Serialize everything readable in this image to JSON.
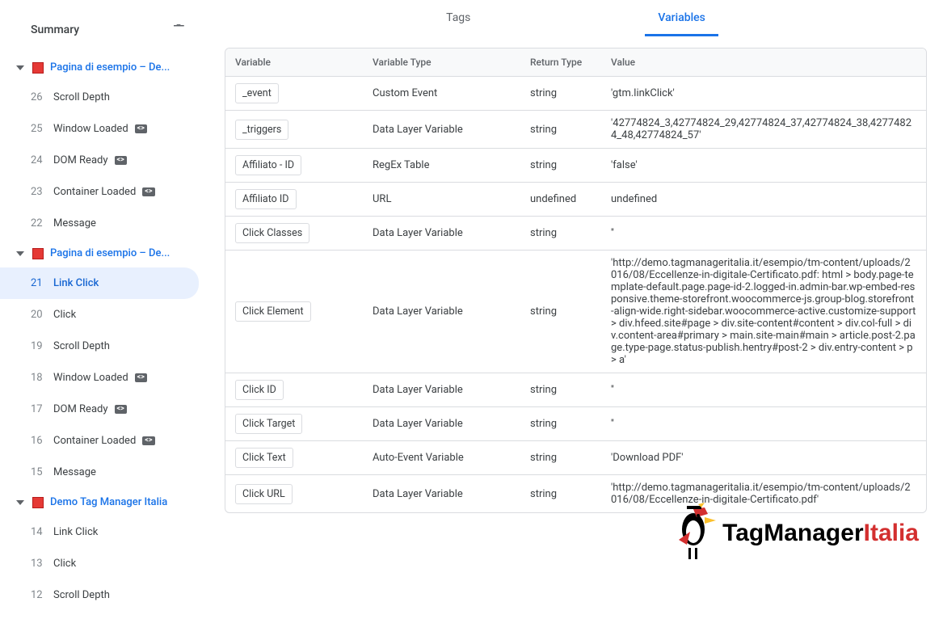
{
  "sidebar": {
    "summary_label": "Summary",
    "groups": [
      {
        "title": "Pagina di esempio – De...",
        "events": [
          {
            "num": "26",
            "label": "Scroll Depth",
            "badge": false
          },
          {
            "num": "25",
            "label": "Window Loaded",
            "badge": true
          },
          {
            "num": "24",
            "label": "DOM Ready",
            "badge": true
          },
          {
            "num": "23",
            "label": "Container Loaded",
            "badge": true
          },
          {
            "num": "22",
            "label": "Message",
            "badge": false
          }
        ]
      },
      {
        "title": "Pagina di esempio – De...",
        "events": [
          {
            "num": "21",
            "label": "Link Click",
            "badge": false,
            "selected": true
          },
          {
            "num": "20",
            "label": "Click",
            "badge": false
          },
          {
            "num": "19",
            "label": "Scroll Depth",
            "badge": false
          },
          {
            "num": "18",
            "label": "Window Loaded",
            "badge": true
          },
          {
            "num": "17",
            "label": "DOM Ready",
            "badge": true
          },
          {
            "num": "16",
            "label": "Container Loaded",
            "badge": true
          },
          {
            "num": "15",
            "label": "Message",
            "badge": false
          }
        ]
      },
      {
        "title": "Demo Tag Manager Italia",
        "events": [
          {
            "num": "14",
            "label": "Link Click",
            "badge": false
          },
          {
            "num": "13",
            "label": "Click",
            "badge": false
          },
          {
            "num": "12",
            "label": "Scroll Depth",
            "badge": false
          }
        ]
      }
    ]
  },
  "main": {
    "tabs": [
      {
        "label": "Tags",
        "active": false
      },
      {
        "label": "Variables",
        "active": true
      }
    ],
    "columns": {
      "variable": "Variable",
      "variable_type": "Variable Type",
      "return_type": "Return Type",
      "value": "Value"
    },
    "rows": [
      {
        "variable": "_event",
        "type": "Custom Event",
        "return": "string",
        "value": "'gtm.linkClick'"
      },
      {
        "variable": "_triggers",
        "type": "Data Layer Variable",
        "return": "string",
        "value": "'42774824_3,42774824_29,42774824_37,42774824_38,42774824_48,42774824_57'"
      },
      {
        "variable": "Affiliato - ID",
        "type": "RegEx Table",
        "return": "string",
        "value": "'false'"
      },
      {
        "variable": "Affiliato ID",
        "type": "URL",
        "return": "undefined",
        "value": "undefined"
      },
      {
        "variable": "Click Classes",
        "type": "Data Layer Variable",
        "return": "string",
        "value": "''"
      },
      {
        "variable": "Click Element",
        "type": "Data Layer Variable",
        "return": "string",
        "value": "'http://demo.tagmanageritalia.it/esempio/tm-content/uploads/2016/08/Eccellenze-in-digitale-Certificato.pdf: html > body.page-template-default.page.page-id-2.logged-in.admin-bar.wp-embed-responsive.theme-storefront.woocommerce-js.group-blog.storefront-align-wide.right-sidebar.woocommerce-active.customize-support > div.hfeed.site#page > div.site-content#content > div.col-full > div.content-area#primary > main.site-main#main > article.post-2.page.type-page.status-publish.hentry#post-2 > div.entry-content > p > a'"
      },
      {
        "variable": "Click ID",
        "type": "Data Layer Variable",
        "return": "string",
        "value": "''"
      },
      {
        "variable": "Click Target",
        "type": "Data Layer Variable",
        "return": "string",
        "value": "''"
      },
      {
        "variable": "Click Text",
        "type": "Auto-Event Variable",
        "return": "string",
        "value": "'Download PDF'"
      },
      {
        "variable": "Click URL",
        "type": "Data Layer Variable",
        "return": "string",
        "value": "'http://demo.tagmanageritalia.it/esempio/tm-content/uploads/2016/08/Eccellenze-in-digitale-Certificato.pdf'"
      }
    ],
    "brand": {
      "tm": "TagManager",
      "it": "Italia"
    }
  }
}
